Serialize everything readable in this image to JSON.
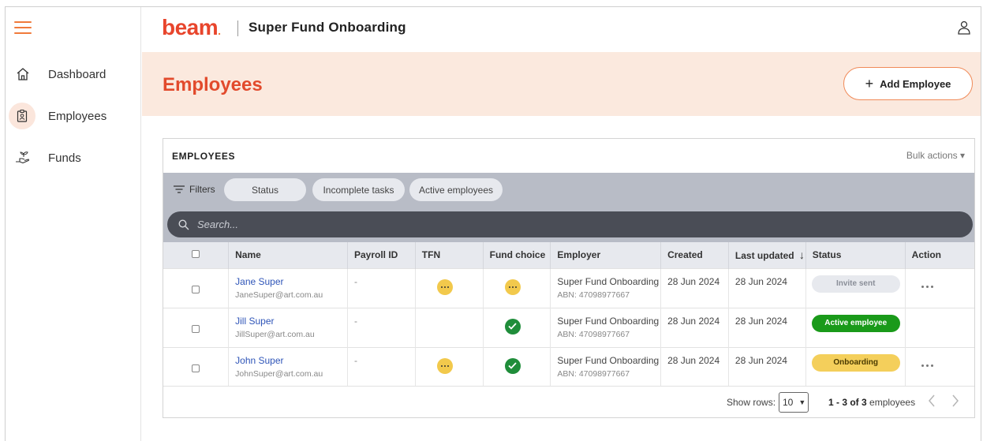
{
  "brand": {
    "logo": "beam",
    "logo_dot": ".",
    "app_title": "Super Fund Onboarding"
  },
  "sidebar": {
    "items": [
      {
        "label": "Dashboard",
        "icon": "home-icon"
      },
      {
        "label": "Employees",
        "icon": "employee-badge-icon",
        "active": true
      },
      {
        "label": "Funds",
        "icon": "plant-hand-icon"
      }
    ]
  },
  "banner": {
    "title": "Employees",
    "add_button": "Add Employee"
  },
  "card": {
    "title": "EMPLOYEES",
    "bulk_actions": "Bulk actions",
    "filters_label": "Filters",
    "chips": [
      "Status",
      "Incomplete tasks",
      "Active employees"
    ],
    "search_placeholder": "Search..."
  },
  "table": {
    "columns": [
      "Name",
      "Payroll ID",
      "TFN",
      "Fund choice",
      "Employer",
      "Created",
      "Last updated",
      "Status",
      "Action"
    ],
    "rows": [
      {
        "name": "Jane Super",
        "email": "JaneSuper@art.com.au",
        "payroll_id": "-",
        "tfn": "pending",
        "fund_choice": "pending",
        "employer": "Super Fund Onboarding",
        "abn": "ABN: 47098977667",
        "created": "28 Jun 2024",
        "last_updated": "28 Jun 2024",
        "status": "Invite sent",
        "status_style": "grey",
        "has_action": true
      },
      {
        "name": "Jill Super",
        "email": "JillSuper@art.com.au",
        "payroll_id": "-",
        "tfn": "none",
        "fund_choice": "done",
        "employer": "Super Fund Onboarding",
        "abn": "ABN: 47098977667",
        "created": "28 Jun 2024",
        "last_updated": "28 Jun 2024",
        "status": "Active employee",
        "status_style": "green",
        "has_action": false
      },
      {
        "name": "John Super",
        "email": "JohnSuper@art.com.au",
        "payroll_id": "-",
        "tfn": "pending",
        "fund_choice": "done",
        "employer": "Super Fund Onboarding",
        "abn": "ABN: 47098977667",
        "created": "28 Jun 2024",
        "last_updated": "28 Jun 2024",
        "status": "Onboarding",
        "status_style": "yellow",
        "has_action": true
      }
    ]
  },
  "footer": {
    "show_rows_label": "Show rows:",
    "rows_value": "10",
    "page_range": "1 - 3 of 3",
    "page_suffix": "employees"
  },
  "colors": {
    "accent": "#e24a2c",
    "orange": "#f07a3b",
    "banner_bg": "#fbe9de",
    "green": "#1a9a1a",
    "yellow": "#f4cf5b"
  }
}
